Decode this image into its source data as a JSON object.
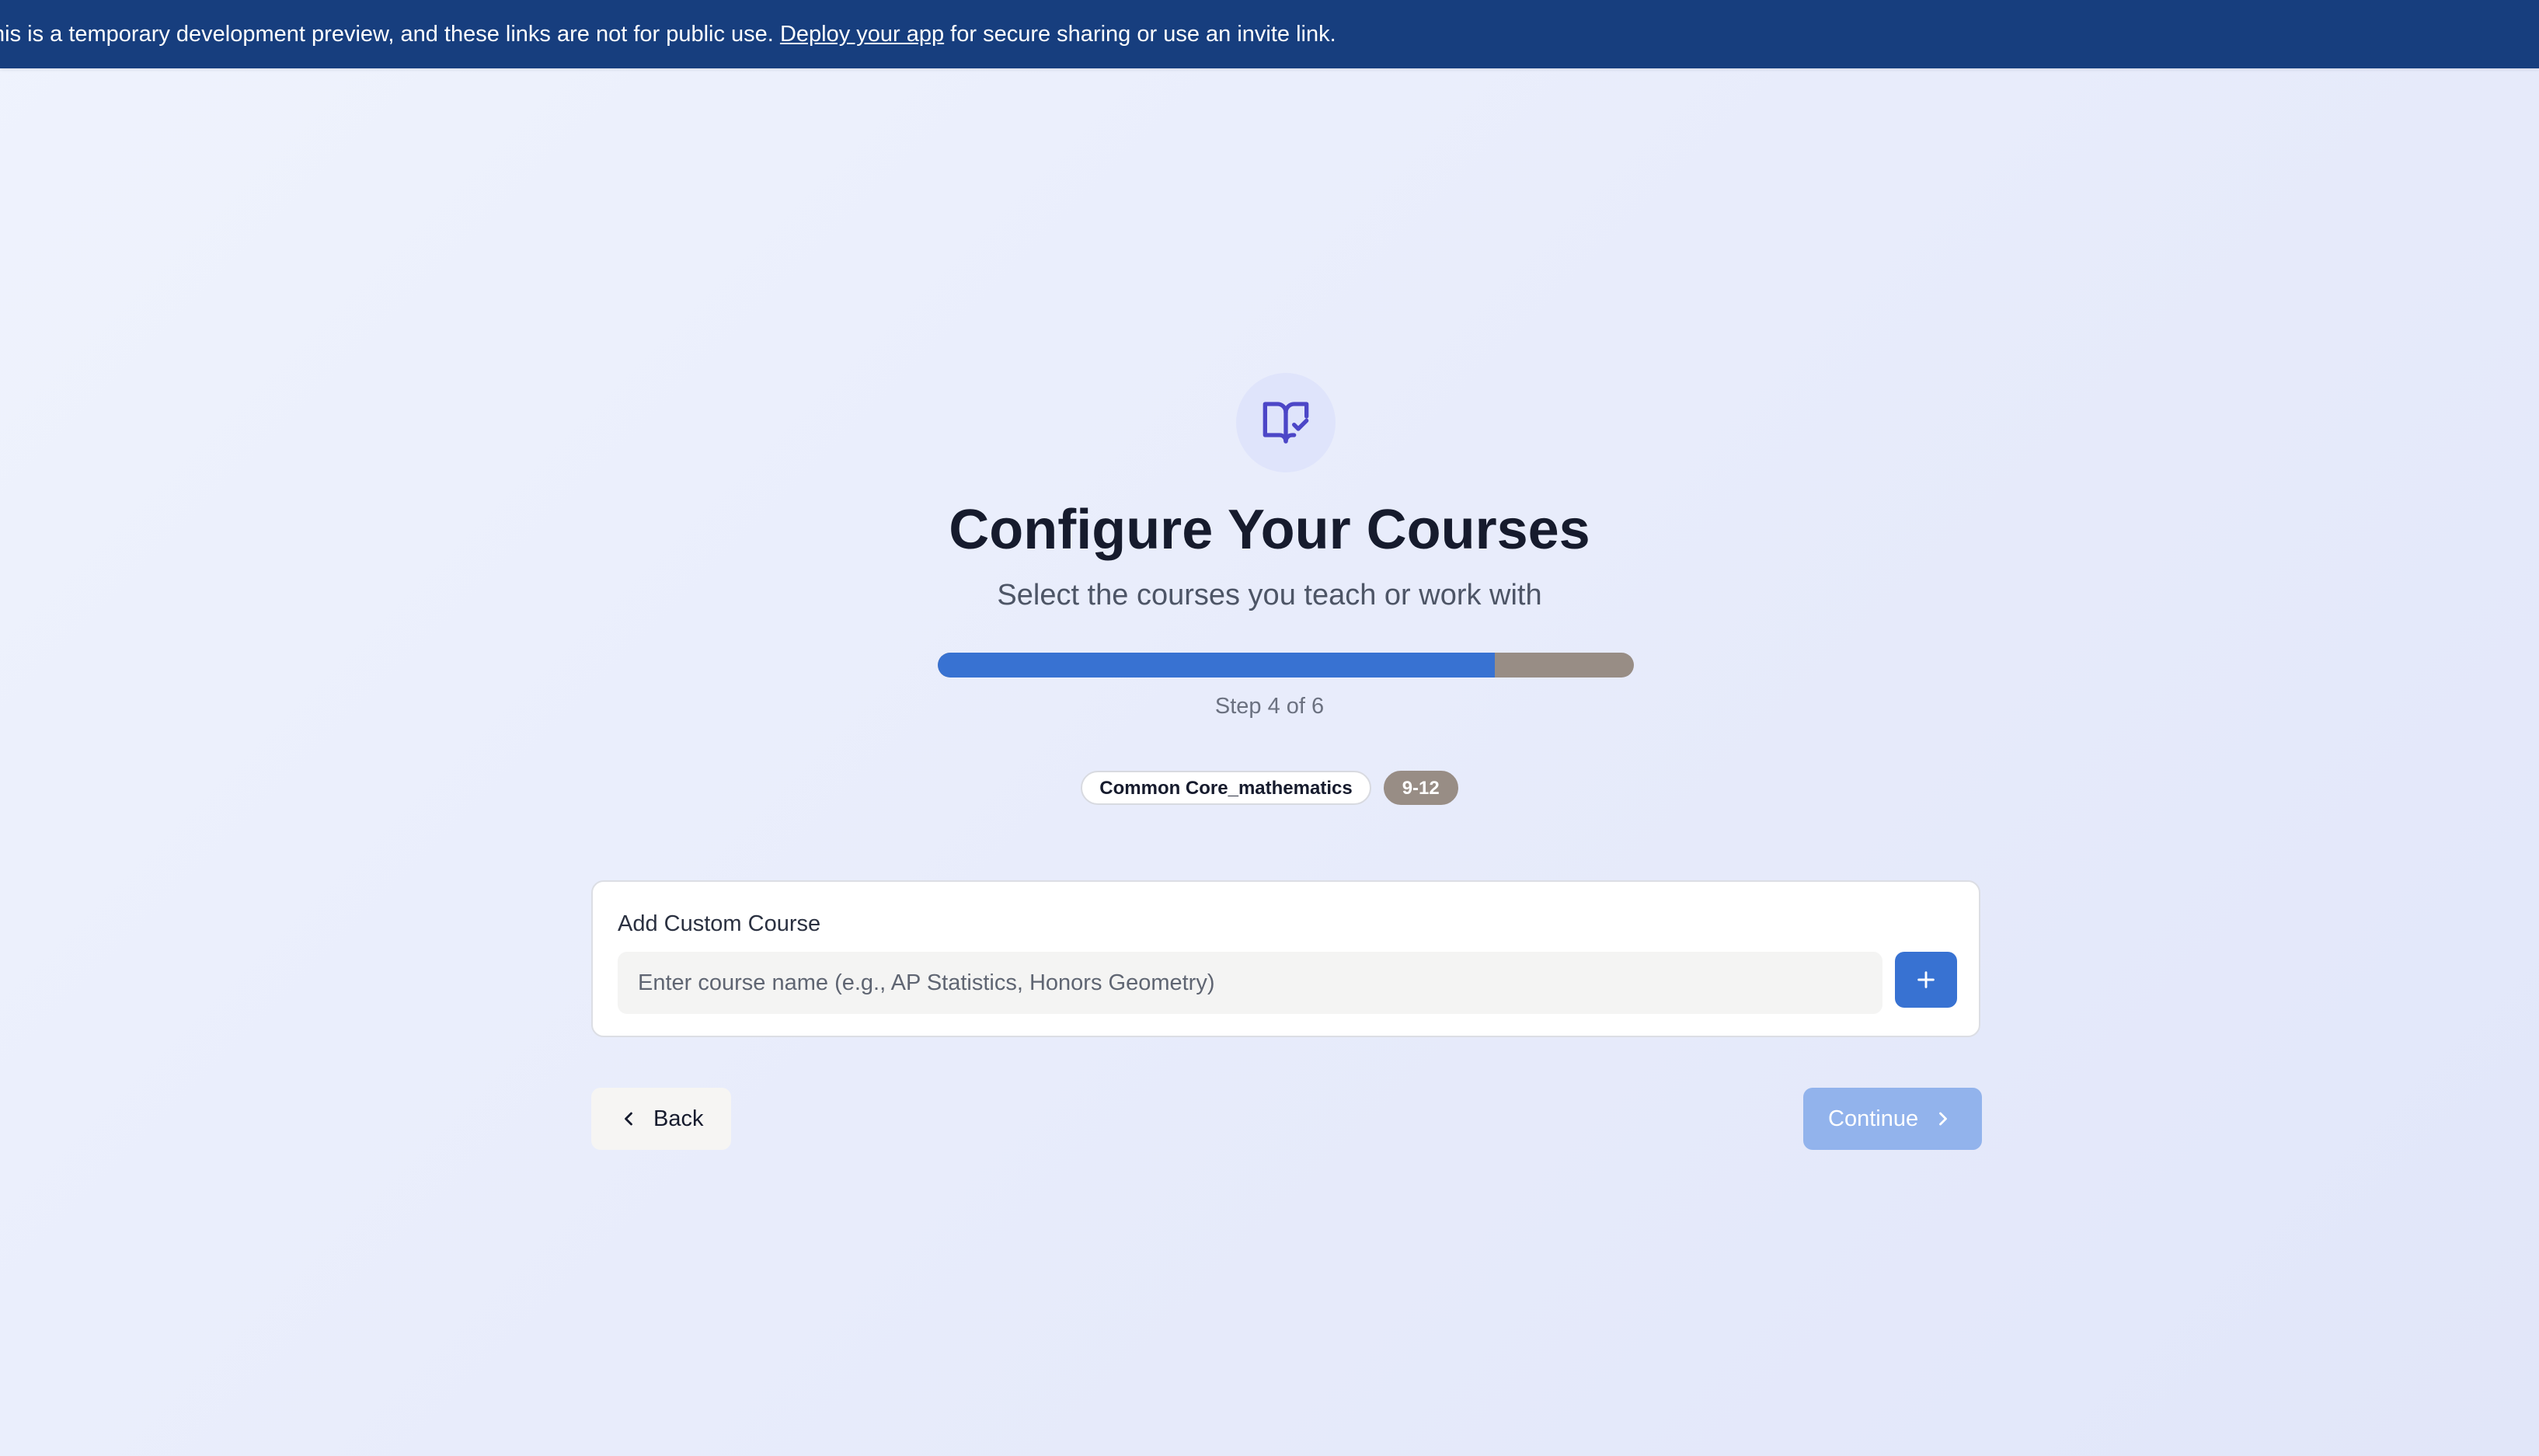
{
  "banner": {
    "text_before": "his is a temporary development preview, and these links are not for public use. ",
    "link_text": "Deploy your app",
    "text_after": " for secure sharing or use an invite link."
  },
  "header": {
    "icon": "book-check-icon",
    "title": "Configure Your Courses",
    "subtitle": "Select the courses you teach or work with"
  },
  "progress": {
    "current_step": 4,
    "total_steps": 6,
    "fill_fraction": 0.8,
    "label": "Step 4 of 6"
  },
  "tags": {
    "standard": "Common Core_mathematics",
    "grade_band": "9-12"
  },
  "custom_course": {
    "label": "Add Custom Course",
    "input_value": "",
    "placeholder": "Enter course name (e.g., AP Statistics, Honors Geometry)",
    "add_icon": "plus-icon"
  },
  "navigation": {
    "back_label": "Back",
    "back_icon": "chevron-left-icon",
    "continue_label": "Continue",
    "continue_icon": "chevron-right-icon",
    "continue_enabled": false
  },
  "colors": {
    "banner_bg": "#173e7e",
    "accent": "#3872d2",
    "progress_remaining": "#988d85",
    "continue_disabled": "#92b3ec",
    "icon_purple": "#4c46c7"
  }
}
